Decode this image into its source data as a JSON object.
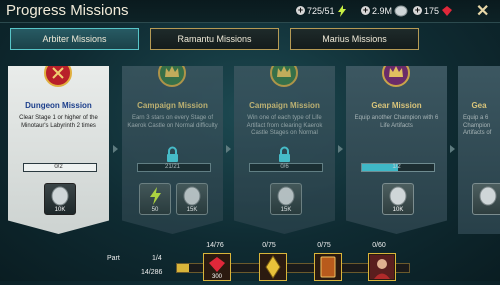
{
  "header": {
    "title": "Progress Missions",
    "energy": "725/51",
    "silver": "2.9M",
    "gems": "175"
  },
  "tabs": [
    {
      "label": "Arbiter Missions",
      "active": true
    },
    {
      "label": "Ramantu Missions",
      "active": false
    },
    {
      "label": "Marius Missions",
      "active": false
    }
  ],
  "cards": [
    {
      "title": "Dungeon Mission",
      "desc": "Clear Stage 1 or higher of the Minotaur's Labyrinth 2 times",
      "progress": "0/2",
      "locked": false,
      "rewards": [
        {
          "icon": "silver-coin-icon",
          "value": "10K"
        }
      ]
    },
    {
      "title": "Campaign Mission",
      "desc": "Earn 3 stars on every Stage of Kaerok Castle on Normal difficulty",
      "progress": "21/21",
      "locked": true,
      "rewards": [
        {
          "icon": "energy-icon",
          "value": "50"
        },
        {
          "icon": "silver-coin-icon",
          "value": "15K"
        }
      ]
    },
    {
      "title": "Campaign Mission",
      "desc": "Win one of each type of Life Artifact from clearing Kaerok Castle Stages on Normal",
      "progress": "0/6",
      "locked": true,
      "rewards": [
        {
          "icon": "silver-coin-icon",
          "value": "15K"
        }
      ]
    },
    {
      "title": "Gear Mission",
      "desc": "Equip another Champion with 6 Life Artifacts",
      "progress": "1/2",
      "locked": false,
      "rewards": [
        {
          "icon": "silver-coin-icon",
          "value": "10K"
        }
      ]
    },
    {
      "title": "Gea",
      "desc": "Equip a 6 Champion Artifacts of",
      "progress": "",
      "locked": false,
      "rewards": [
        {
          "icon": "silver-coin-icon",
          "value": ""
        }
      ]
    }
  ],
  "footer": {
    "part_label": "Part",
    "part_value": "1/4",
    "total_value": "14/286",
    "progress_fraction": 0.05,
    "milestones": [
      {
        "count": "14/76",
        "value": "300",
        "icon": "ruby-icon"
      },
      {
        "count": "0/75",
        "value": "",
        "icon": "shard-icon"
      },
      {
        "count": "0/75",
        "value": "",
        "icon": "card-icon"
      },
      {
        "count": "0/60",
        "value": "",
        "icon": "champion-icon"
      }
    ]
  },
  "colors": {
    "accent_gold": "#d9b53a",
    "active_tab": "#275a63"
  }
}
